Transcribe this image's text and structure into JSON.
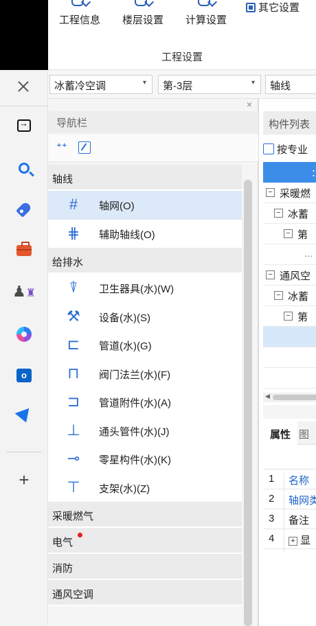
{
  "ribbon": {
    "buttons": [
      {
        "label": "工程信息"
      },
      {
        "label": "楼层设置"
      },
      {
        "label": "计算设置"
      }
    ],
    "other_label": "其它设置",
    "group_label": "工程设置"
  },
  "toolbar": {
    "project_select": "冰蓄冷空调",
    "floor_select": "第-3层",
    "type_select": "轴线"
  },
  "nav": {
    "title": "导航栏",
    "close": "×",
    "sections": [
      {
        "name": "轴线",
        "items": [
          {
            "label": "轴网(O)",
            "icon": "grid-icon",
            "selected": true
          },
          {
            "label": "辅助轴线(O)",
            "icon": "auxiliary-axis-icon"
          }
        ]
      },
      {
        "name": "给排水",
        "items": [
          {
            "label": "卫生器具(水)(W)",
            "icon": "sanitary-fixture-icon"
          },
          {
            "label": "设备(水)(S)",
            "icon": "equipment-icon"
          },
          {
            "label": "管道(水)(G)",
            "icon": "pipe-icon"
          },
          {
            "label": "阀门法兰(水)(F)",
            "icon": "valve-flange-icon"
          },
          {
            "label": "管道附件(水)(A)",
            "icon": "pipe-fitting-icon"
          },
          {
            "label": "通头管件(水)(J)",
            "icon": "tee-fitting-icon"
          },
          {
            "label": "零星构件(水)(K)",
            "icon": "misc-component-icon"
          },
          {
            "label": "支架(水)(Z)",
            "icon": "bracket-icon"
          }
        ]
      }
    ],
    "collapsed_sections": [
      {
        "name": "采暖燃气"
      },
      {
        "name": "电气",
        "badge": true
      },
      {
        "name": "消防"
      },
      {
        "name": "通风空调"
      }
    ]
  },
  "component_panel": {
    "title": "构件列表",
    "filter_button": "按专业",
    "tree": [
      {
        "expander": "−",
        "label": "采暖燃"
      },
      {
        "expander": "−",
        "label": "冰蓄"
      },
      {
        "expander": "−",
        "label": "第"
      },
      {
        "expander": "",
        "label": "..."
      },
      {
        "expander": "−",
        "label": "通风空"
      },
      {
        "expander": "−",
        "label": "冰蓄"
      },
      {
        "expander": "−",
        "label": "第"
      },
      {
        "expander": "",
        "label": "",
        "selected": true
      },
      {
        "expander": "",
        "label": ""
      },
      {
        "expander": "",
        "label": ""
      }
    ]
  },
  "properties": {
    "tab_active": "属性",
    "tab_other": "图",
    "rows": [
      {
        "num": "1",
        "name": "名称",
        "blue": true
      },
      {
        "num": "2",
        "name": "轴网类",
        "blue": true
      },
      {
        "num": "3",
        "name": "备注",
        "blue": false
      },
      {
        "num": "4",
        "name": "显",
        "expander": "+",
        "blue": false
      }
    ]
  },
  "colors": {
    "accent": "#2b6fd6",
    "selected_bg": "#dce9f9",
    "header_blue": "#3c8de8",
    "badge_red": "#e61e1e"
  }
}
